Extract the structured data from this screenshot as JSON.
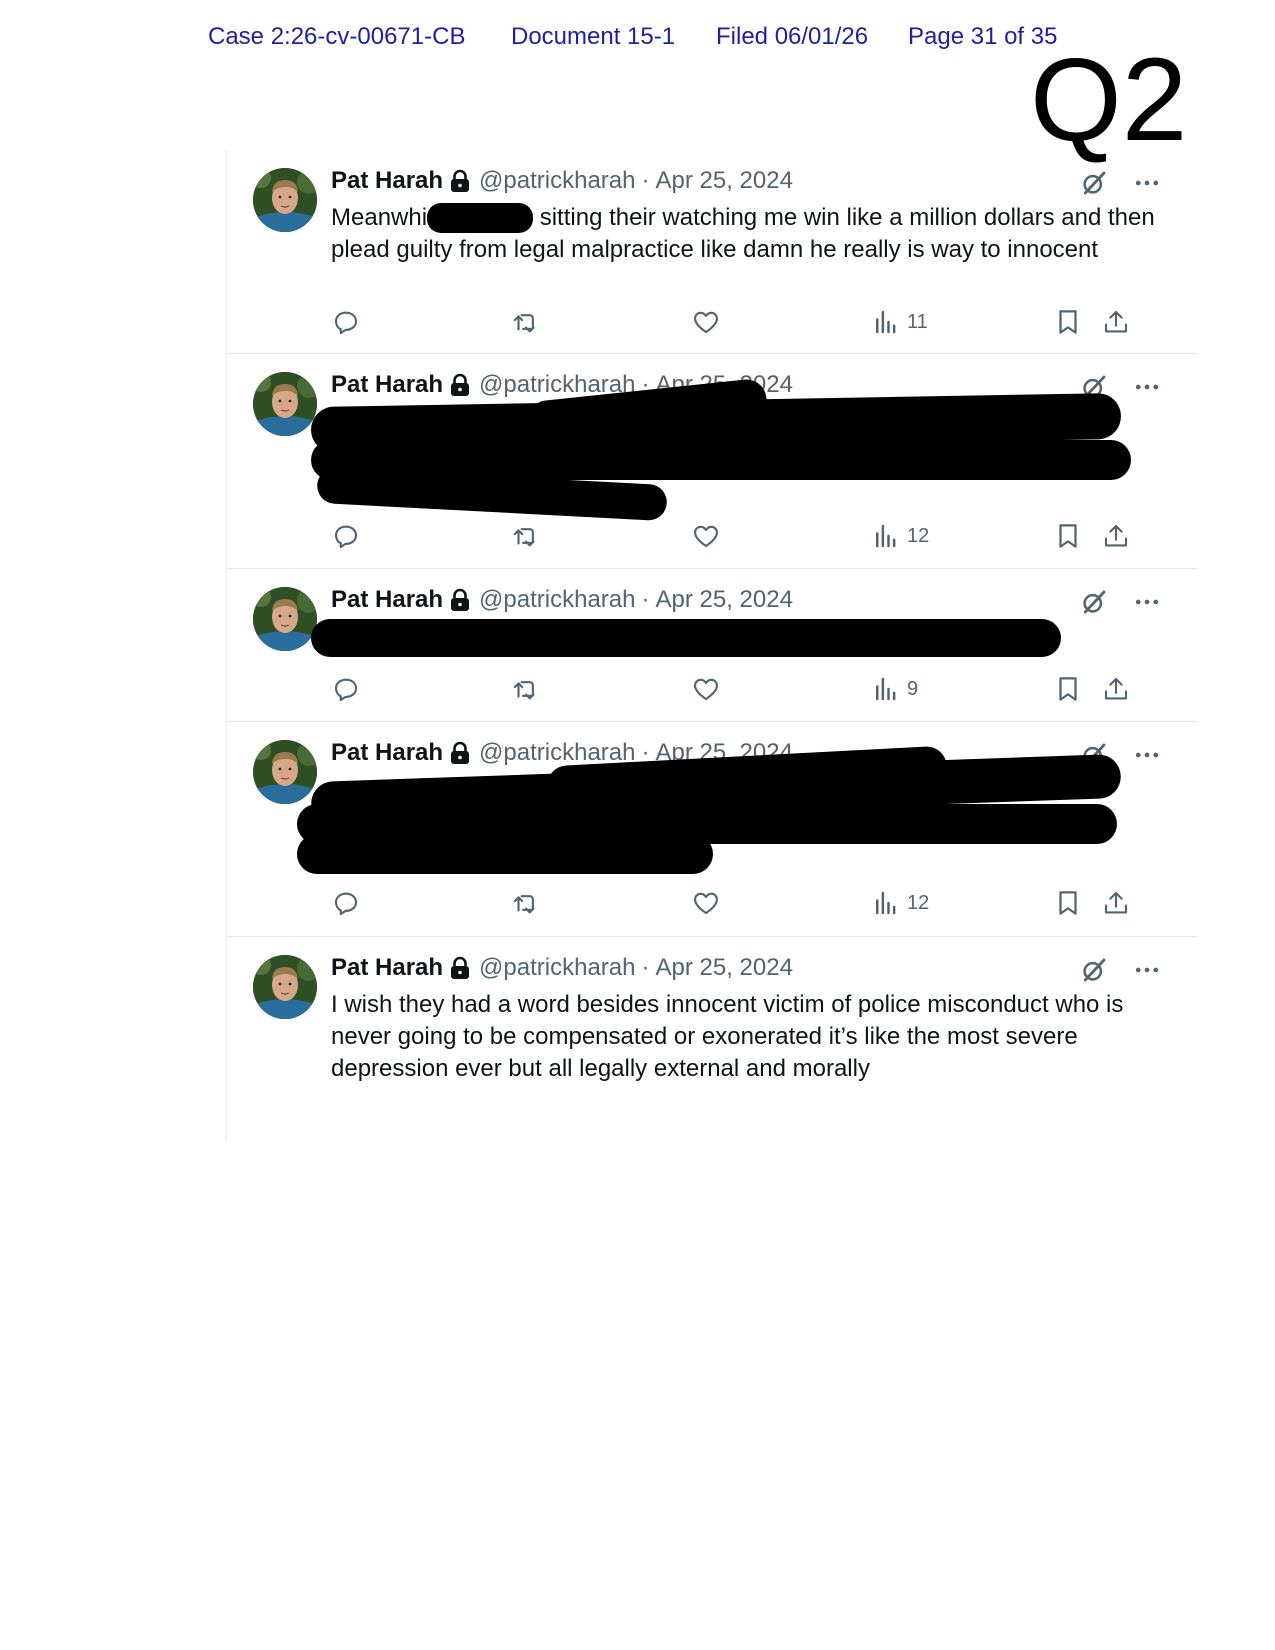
{
  "case_header": {
    "case": "Case 2:26-cv-00671-CB",
    "document": "Document 15-1",
    "filed": "Filed 06/01/26",
    "page": "Page 31 of 35"
  },
  "exhibit_label": "Q2",
  "tweets": [
    {
      "name": "Pat Harah",
      "handle": "@patrickharah",
      "sep": "·",
      "date": "Apr 25, 2024",
      "text_before": "Meanwhi",
      "text_after": " sitting their watching me win like a million dollars and then plead guilty from legal malpractice like damn he really is way to innocent",
      "views": "11"
    },
    {
      "name": "Pat Harah",
      "handle": "@patrickharah",
      "sep": "·",
      "date": "Apr 25, 2024",
      "views": "12"
    },
    {
      "name": "Pat Harah",
      "handle": "@patrickharah",
      "sep": "·",
      "date": "Apr 25, 2024",
      "views": "9"
    },
    {
      "name": "Pat Harah",
      "handle": "@patrickharah",
      "sep": "·",
      "date": "Apr 25, 2024",
      "views": "12"
    },
    {
      "name": "Pat Harah",
      "handle": "@patrickharah",
      "sep": "·",
      "date": "Apr 25, 2024",
      "text": "I wish they had a word besides innocent victim of police misconduct who is never going to be compensated or exonerated it’s like the most severe depression ever but all legally external and morally"
    }
  ],
  "icons": {
    "reply": "reply-icon",
    "retweet": "retweet-icon",
    "like": "heart-icon",
    "views": "views-chart-icon",
    "bookmark": "bookmark-icon",
    "share": "share-icon",
    "grok": "grok-icon",
    "more": "more-icon",
    "lock": "lock-icon"
  },
  "colors": {
    "header_text": "#1f1fa0",
    "secondary_text": "#536471",
    "primary_text": "#0f1419",
    "redaction": "#000000"
  }
}
